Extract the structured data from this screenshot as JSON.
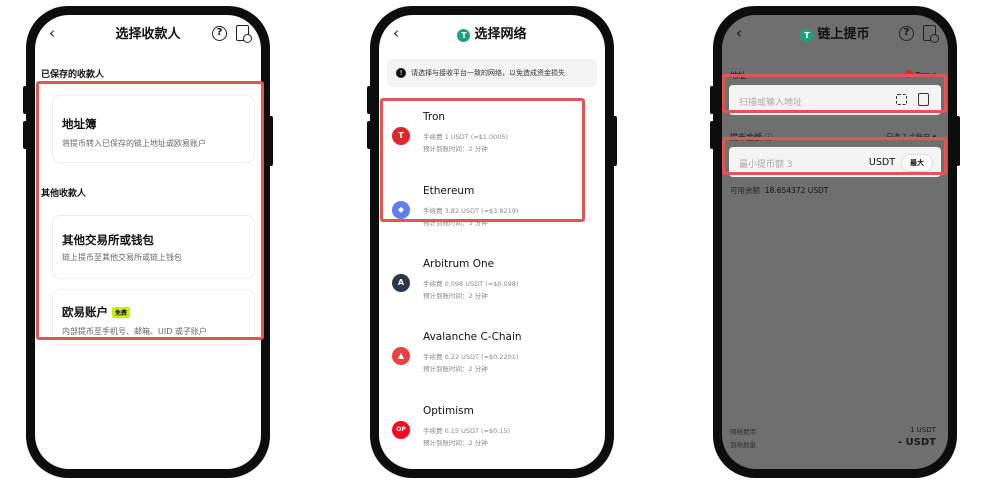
{
  "screen1": {
    "title": "选择收款人",
    "back_icon": "chevron-left-icon",
    "saved_label": "已保存的收款人",
    "address_book": {
      "title": "地址簿",
      "subtitle": "将提币转入已保存的链上地址或欧易账户"
    },
    "other_label": "其他收款人",
    "other_exchange": {
      "title": "其他交易所或钱包",
      "subtitle": "链上提币至其他交易所或链上钱包"
    },
    "okx_account": {
      "title": "欧易账户",
      "badge": "免费",
      "subtitle": "内部提币至手机号、邮箱、UID 或子账户"
    }
  },
  "screen2": {
    "title": "选择网络",
    "notice": "请选择与接收平台一致的网络，以免造成资金损失",
    "networks": [
      {
        "name": "Tron",
        "fee": "手续费 1 USDT (≈$1.0005)",
        "eta": "预计到账时间：2 分钟",
        "color": "#e0262b",
        "glyph": "T"
      },
      {
        "name": "Ethereum",
        "fee": "手续费 3.82 USDT (≈$3.8219)",
        "eta": "预计到账时间：3 分钟",
        "color": "#627eea",
        "glyph": "◆"
      },
      {
        "name": "Arbitrum One",
        "fee": "手续费 0.098 USDT (≈$0.098)",
        "eta": "预计到账时间：2 分钟",
        "color": "#2d374b",
        "glyph": "A"
      },
      {
        "name": "Avalanche C-Chain",
        "fee": "手续费 0.22 USDT (≈$0.2201)",
        "eta": "预计到账时间：2 分钟",
        "color": "#e84142",
        "glyph": "▲"
      },
      {
        "name": "Optimism",
        "fee": "手续费 0.15 USDT (≈$0.15)",
        "eta": "预计到账时间：2 分钟",
        "color": "#ff0420",
        "glyph": "OP"
      }
    ]
  },
  "screen3": {
    "title": "链上提币",
    "address_label": "地址",
    "network_value": "Tron",
    "address_placeholder": "扫描或输入地址",
    "amount_label": "提币金额",
    "selected_accounts": "已选 1 个账户",
    "amount_placeholder": "最小提币额 3",
    "unit": "USDT",
    "max_label": "最大",
    "available_label": "可用余额",
    "available_value": "18.654372 USDT",
    "fee_label": "网络费用",
    "fee_value": "1 USDT",
    "receive_label": "到账数量",
    "receive_value": "- USDT"
  }
}
